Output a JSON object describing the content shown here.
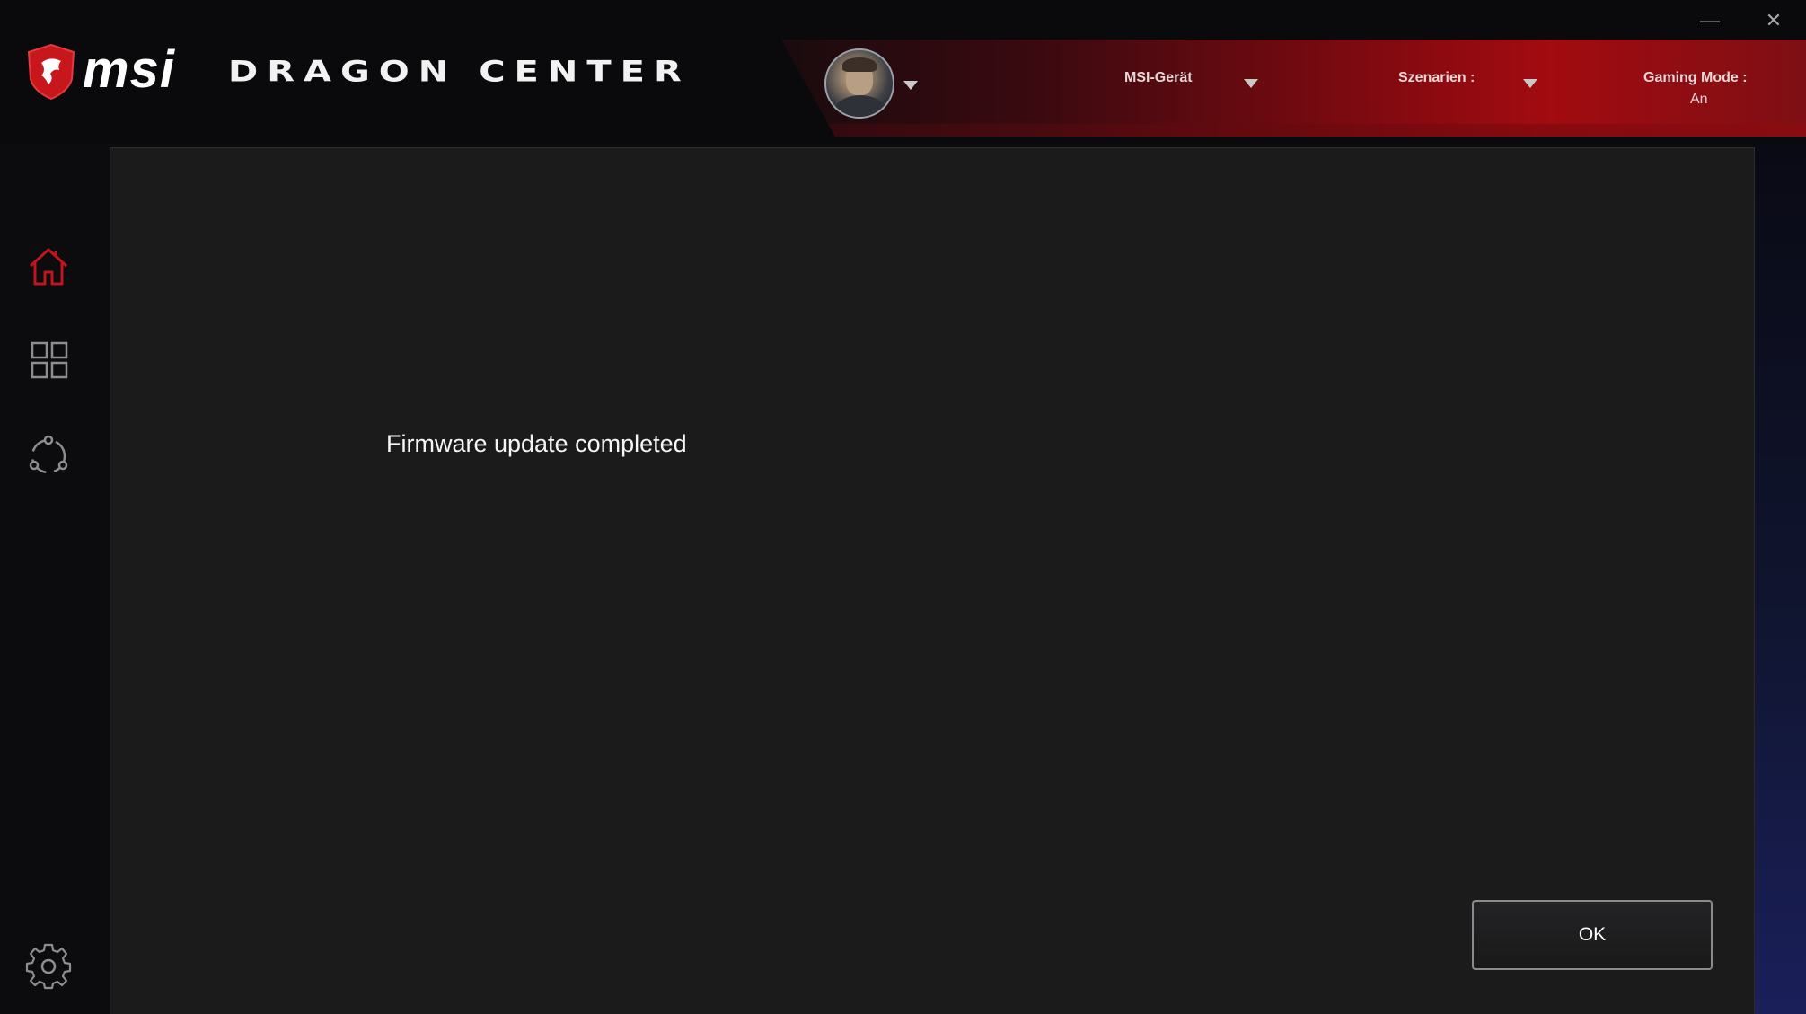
{
  "header": {
    "brand": "msi",
    "app_title": "DRAGON CENTER",
    "device_menu_label": "MSI-Gerät",
    "scenario_menu_label": "Szenarien :",
    "gaming_mode_label": "Gaming Mode :",
    "gaming_mode_value": "An"
  },
  "window_controls": {
    "minimize": "—",
    "close": "✕"
  },
  "sidebar": {
    "items": [
      {
        "icon": "home-icon",
        "active": true
      },
      {
        "icon": "apps-grid-icon",
        "active": false
      },
      {
        "icon": "network-icon",
        "active": false
      },
      {
        "icon": "settings-gear-icon",
        "active": false
      }
    ]
  },
  "dialog": {
    "message": "Firmware update completed",
    "ok_label": "OK"
  },
  "colors": {
    "accent_red": "#b3151b",
    "dialog_bg": "#1b1b1c",
    "app_bg": "#0c0c0e"
  }
}
